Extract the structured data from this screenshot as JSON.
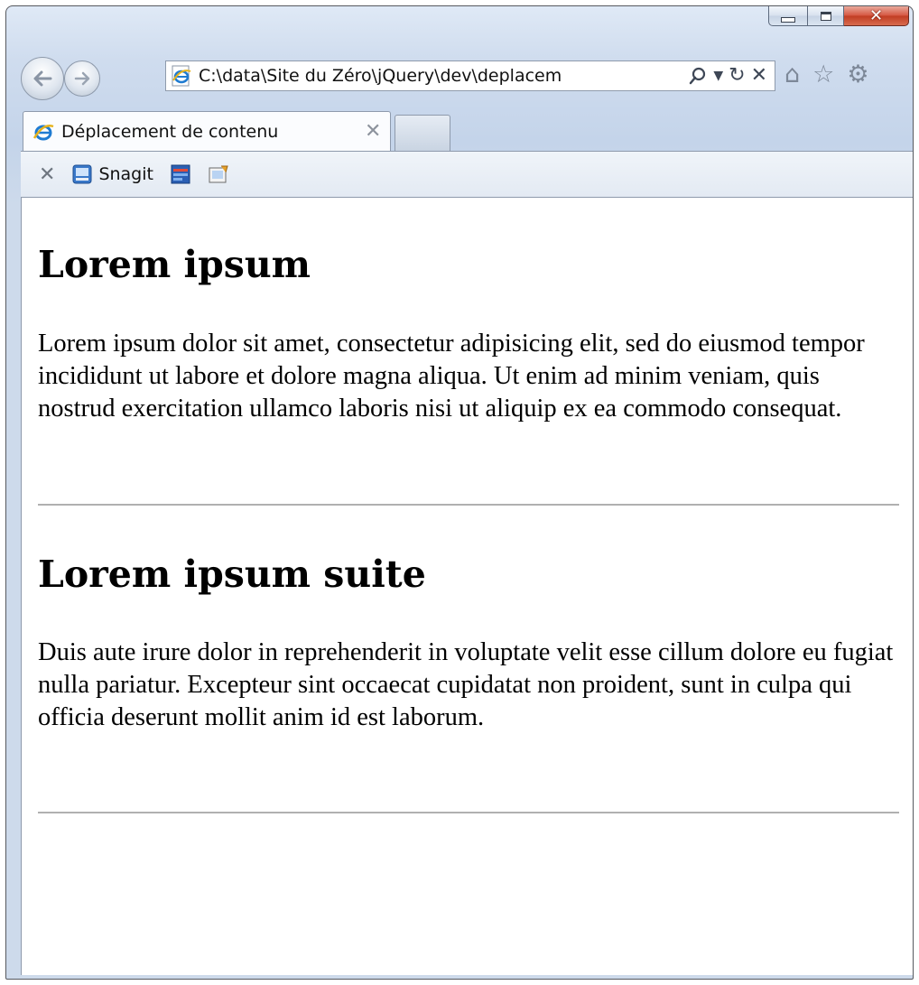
{
  "browser": {
    "address_url": "C:\\data\\Site du Zéro\\jQuery\\dev\\deplacem",
    "tab_title": "Déplacement de contenu",
    "command_bar": {
      "snagit_label": "Snagit"
    }
  },
  "page": {
    "sections": [
      {
        "heading": "Lorem ipsum",
        "text": "Lorem ipsum dolor sit amet, consectetur adipisicing elit, sed do eiusmod tempor incididunt ut labore et dolore magna aliqua. Ut enim ad minim veniam, quis nostrud exercitation ullamco laboris nisi ut aliquip ex ea commodo consequat."
      },
      {
        "heading": "Lorem ipsum suite",
        "text": "Duis aute irure dolor in reprehenderit in voluptate velit esse cillum dolore eu fugiat nulla pariatur. Excepteur sint occaecat cupidatat non proident, sunt in culpa qui officia deserunt mollit anim id est laborum."
      }
    ]
  }
}
